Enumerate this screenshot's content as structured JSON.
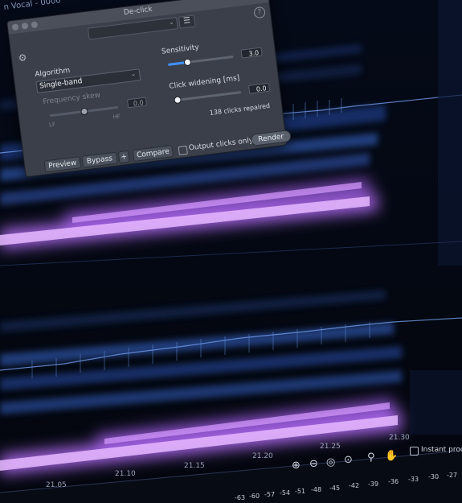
{
  "document": {
    "title": "n Vocal - 0000"
  },
  "declick": {
    "window_title": "De-click",
    "algorithm": {
      "label": "Algorithm",
      "value": "Single-band"
    },
    "frequency_skew": {
      "label": "Frequency skew",
      "value": "0.0",
      "low": "LF",
      "high": "HF",
      "level": 0.5,
      "enabled": false
    },
    "sensitivity": {
      "label": "Sensitivity",
      "value": "3.0",
      "level": 0.3
    },
    "click_widening": {
      "label": "Click widening [ms]",
      "value": "0.0",
      "level": 0.0
    },
    "status": "138 clicks repaired",
    "buttons": {
      "preview": "Preview",
      "bypass": "Bypass",
      "plus": "+",
      "compare": "Compare",
      "render": "Render"
    },
    "output_clicks_only": {
      "label": "Output clicks only",
      "checked": false
    },
    "icons": [
      "gear-icon",
      "help-icon",
      "menu-icon"
    ]
  },
  "timeline": {
    "labels": [
      "21.05",
      "21.10",
      "21.15",
      "21.20",
      "21.25",
      "21.30"
    ]
  },
  "toolbar": {
    "icons": [
      "zoom-in-icon",
      "zoom-out-icon",
      "zoom-fit-icon",
      "zoom-selection-icon",
      "magnifier-icon",
      "hand-icon"
    ],
    "instant_process": {
      "label": "Instant proc",
      "checked": false
    }
  },
  "meter": {
    "db_scale": [
      "-63",
      "-60",
      "-57",
      "-54",
      "-51",
      "-48",
      "-45",
      "-42",
      "-39",
      "-36",
      "-33",
      "-30",
      "-27"
    ]
  },
  "colors": {
    "accent": "#3e90ff",
    "spectral_purple": "#c77dff",
    "spectral_blue": "#3a6fe0"
  }
}
